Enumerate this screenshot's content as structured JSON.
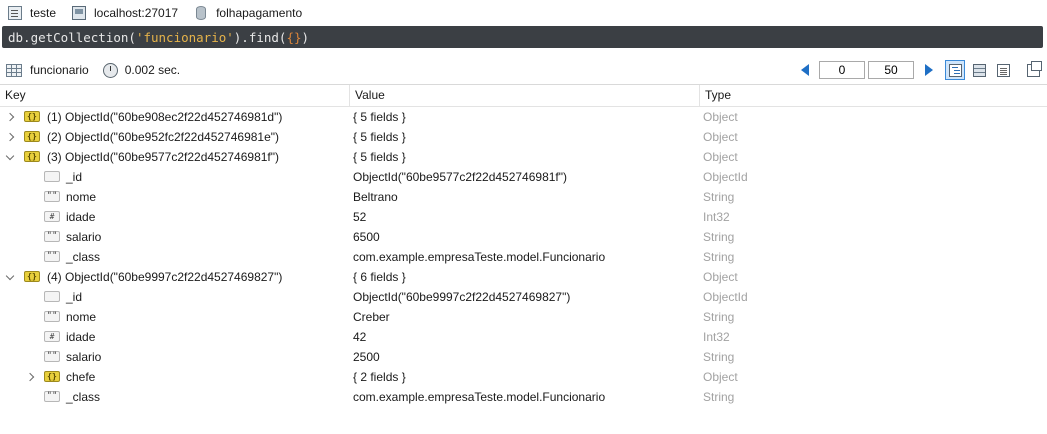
{
  "path": {
    "shell": "teste",
    "server": "localhost:27017",
    "database": "folhapagamento"
  },
  "query": {
    "prefix": "db.getCollection(",
    "collection": "'funcionario'",
    "middle": ").find(",
    "args": "{}",
    "suffix": ")"
  },
  "toolbar": {
    "collection": "funcionario",
    "time": "0.002 sec.",
    "skip": "0",
    "limit": "50",
    "view_mode": "tree"
  },
  "columns": {
    "key": "Key",
    "value": "Value",
    "type": "Type"
  },
  "rows": [
    {
      "key": "(1) ObjectId(\"60be908ec2f22d452746981d\")",
      "value": "{ 5 fields }",
      "type": "Object",
      "icon": "object-icon",
      "depth": 0,
      "caret": "collapsed"
    },
    {
      "key": "(2) ObjectId(\"60be952fc2f22d452746981e\")",
      "value": "{ 5 fields }",
      "type": "Object",
      "icon": "object-icon",
      "depth": 0,
      "caret": "collapsed"
    },
    {
      "key": "(3) ObjectId(\"60be9577c2f22d452746981f\")",
      "value": "{ 5 fields }",
      "type": "Object",
      "icon": "object-icon",
      "depth": 0,
      "caret": "expanded"
    },
    {
      "key": "_id",
      "value": "ObjectId(\"60be9577c2f22d452746981f\")",
      "type": "ObjectId",
      "icon": "objectid-icon",
      "depth": 1,
      "caret": "none"
    },
    {
      "key": "nome",
      "value": "Beltrano",
      "type": "String",
      "icon": "string-icon",
      "depth": 1,
      "caret": "none"
    },
    {
      "key": "idade",
      "value": "52",
      "type": "Int32",
      "icon": "int-icon",
      "depth": 1,
      "caret": "none"
    },
    {
      "key": "salario",
      "value": "6500",
      "type": "String",
      "icon": "string-icon",
      "depth": 1,
      "caret": "none"
    },
    {
      "key": "_class",
      "value": "com.example.empresaTeste.model.Funcionario",
      "type": "String",
      "icon": "string-icon",
      "depth": 1,
      "caret": "none"
    },
    {
      "key": "(4) ObjectId(\"60be9997c2f22d4527469827\")",
      "value": "{ 6 fields }",
      "type": "Object",
      "icon": "object-icon",
      "depth": 0,
      "caret": "expanded"
    },
    {
      "key": "_id",
      "value": "ObjectId(\"60be9997c2f22d4527469827\")",
      "type": "ObjectId",
      "icon": "objectid-icon",
      "depth": 1,
      "caret": "none"
    },
    {
      "key": "nome",
      "value": "Creber",
      "type": "String",
      "icon": "string-icon",
      "depth": 1,
      "caret": "none"
    },
    {
      "key": "idade",
      "value": "42",
      "type": "Int32",
      "icon": "int-icon",
      "depth": 1,
      "caret": "none"
    },
    {
      "key": "salario",
      "value": "2500",
      "type": "String",
      "icon": "string-icon",
      "depth": 1,
      "caret": "none"
    },
    {
      "key": "chefe",
      "value": "{ 2 fields }",
      "type": "Object",
      "icon": "object-icon",
      "depth": 1,
      "caret": "collapsed"
    },
    {
      "key": "_class",
      "value": "com.example.empresaTeste.model.Funcionario",
      "type": "String",
      "icon": "string-icon",
      "depth": 1,
      "caret": "none"
    }
  ]
}
